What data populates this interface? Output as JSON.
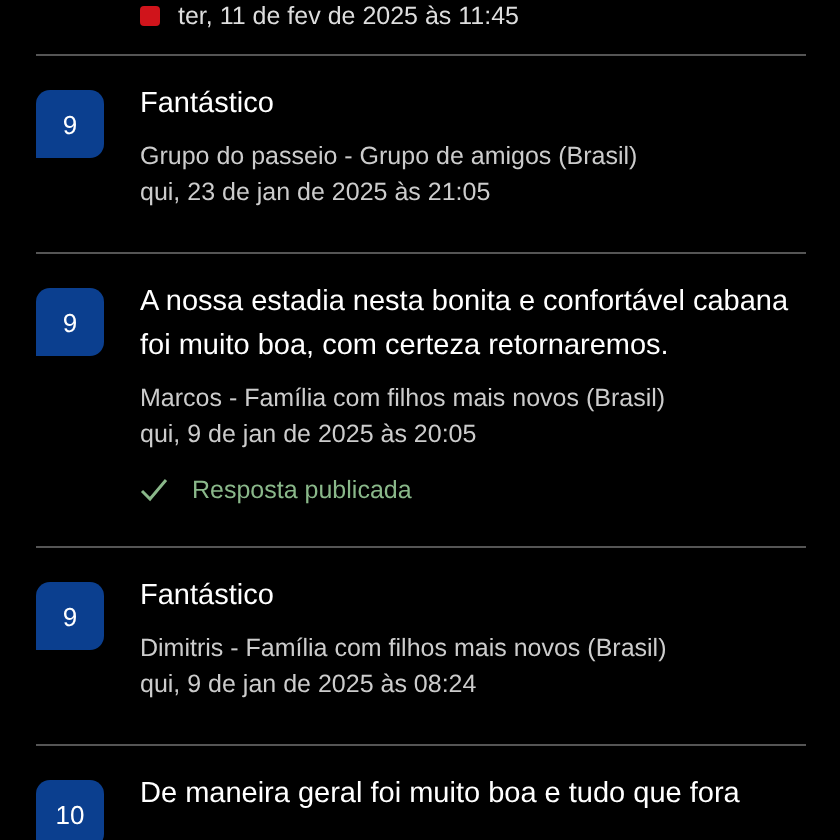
{
  "previous_review": {
    "date": "ter, 11 de fev de 2025 às 11:45"
  },
  "reviews": [
    {
      "score": "9",
      "title": "Fantástico",
      "author": "Grupo do passeio - Grupo de amigos (Brasil)",
      "date": "qui, 23 de jan de 2025 às 21:05",
      "reply_published": false
    },
    {
      "score": "9",
      "title": "A nossa estadia nesta bonita e confortável  cabana foi muito boa, com certeza retornaremos.",
      "author": "Marcos - Família com filhos mais novos (Brasil)",
      "date": "qui, 9 de jan de 2025 às 20:05",
      "reply_published": true,
      "reply_label": "Resposta publicada"
    },
    {
      "score": "9",
      "title": "Fantástico",
      "author": "Dimitris - Família com filhos mais novos (Brasil)",
      "date": "qui, 9 de jan de 2025 às 08:24",
      "reply_published": false
    },
    {
      "score": "10",
      "title": "De maneira geral foi muito boa e tudo que fora"
    }
  ]
}
